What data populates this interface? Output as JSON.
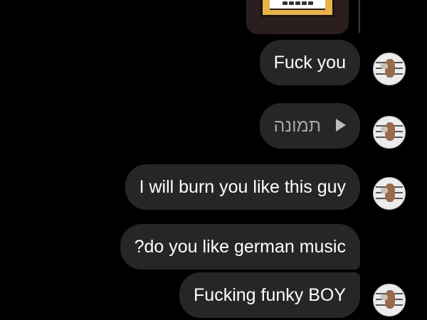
{
  "messages": [
    {
      "type": "image",
      "text": ""
    },
    {
      "type": "text",
      "text": "Fuck you"
    },
    {
      "type": "media",
      "text": "תמונה",
      "icon": "play-icon"
    },
    {
      "type": "text",
      "text": "I will burn you like this guy"
    },
    {
      "type": "text",
      "text": "?do you like german music"
    },
    {
      "type": "text",
      "text": "Fucking funky BOY"
    }
  ],
  "colors": {
    "background": "#000000",
    "bubble": "#262626",
    "bubble_text": "#ffffff",
    "media_text": "#a6a6a6"
  }
}
